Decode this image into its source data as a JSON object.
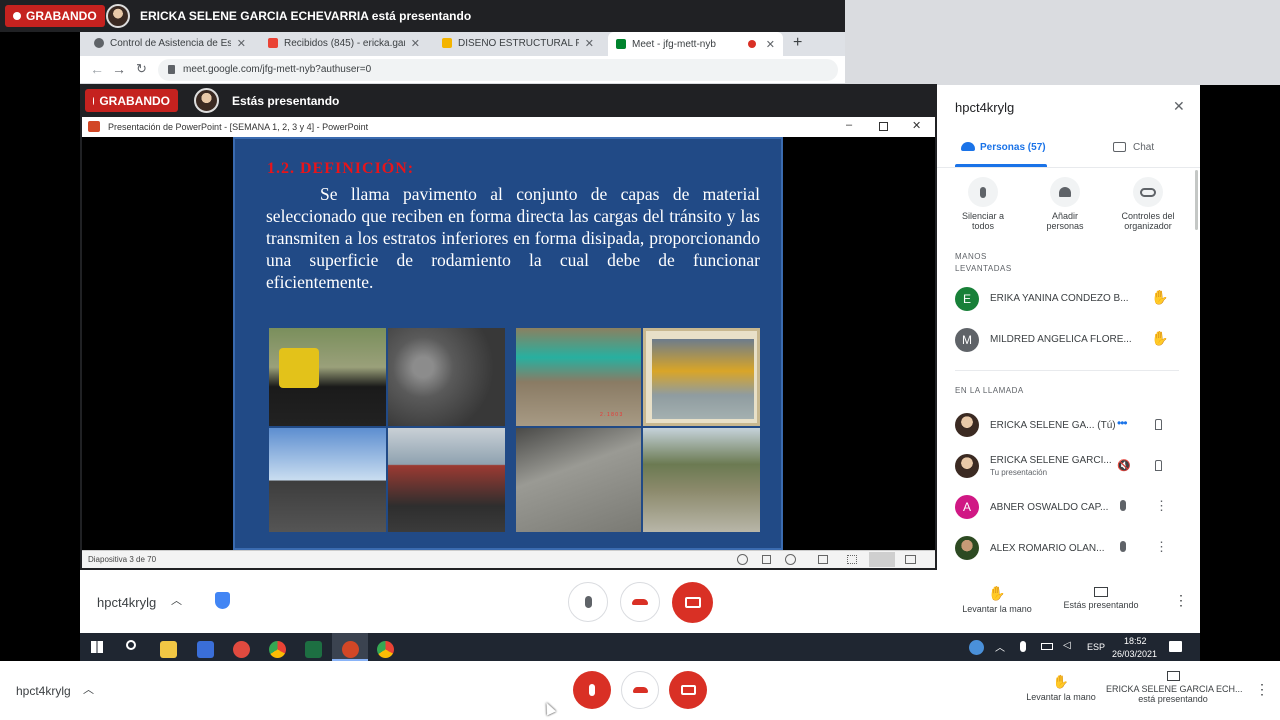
{
  "top_bar": {
    "recording": "GRABANDO",
    "presenter": "ERICKA SELENE GARCIA ECHEVARRIA está presentando"
  },
  "browser": {
    "tabs": [
      {
        "label": "Control de Asistencia de Estudia"
      },
      {
        "label": "Recibidos (845) - ericka.garcia@"
      },
      {
        "label": "DISEÑO ESTRUCTURAL PAVIMEN"
      },
      {
        "label": "Meet - jfg-mett-nyb"
      }
    ],
    "new_tab": "+",
    "url": "meet.google.com/jfg-mett-nyb?authuser=0"
  },
  "inner_bar": {
    "recording": "GRABANDO",
    "presenting": "Estás presentando"
  },
  "ppt": {
    "title": "Presentación de PowerPoint - [SEMANA 1, 2, 3 y 4] - PowerPoint",
    "heading": "1.2. DEFINICIÓN:",
    "body": "Se llama pavimento al conjunto de capas de material seleccionado que reciben en forma directa las cargas del tránsito y las transmiten a los estratos inferiores en forma disipada, proporcionando una superficie de rodamiento la cual debe de funcionar eficientemente.",
    "status": "Diapositiva 3 de 70",
    "photo_stamp": "2 . 1 8 0 3"
  },
  "meet_inner": {
    "code": "hpct4krylg",
    "raise_hand": "Levantar la mano",
    "presenting": "Estás presentando"
  },
  "taskbar": {
    "lang": "ESP",
    "time": "18:52",
    "date": "26/03/2021"
  },
  "side": {
    "title": "hpct4krylg",
    "tab_people": "Personas (57)",
    "tab_chat": "Chat",
    "controls": [
      {
        "line1": "Silenciar a",
        "line2": "todos"
      },
      {
        "line1": "Añadir",
        "line2": "personas"
      },
      {
        "line1": "Controles del",
        "line2": "organizador"
      }
    ],
    "raised_header_1": "MANOS",
    "raised_header_2": "LEVANTADAS",
    "raised": [
      {
        "initial": "E",
        "name": "ERIKA YANINA CONDEZO B...",
        "color": "#188038"
      },
      {
        "initial": "M",
        "name": "MILDRED ANGELICA FLORE...",
        "color": "#5f6368"
      }
    ],
    "call_header": "EN LA LLAMADA",
    "in_call": [
      {
        "name": "ERICKA SELENE GA... (Tú)",
        "sub": ""
      },
      {
        "name": "ERICKA SELENE GARCI...",
        "sub": "Tu presentación"
      },
      {
        "initial": "A",
        "name": "ABNER OSWALDO CAP...",
        "sub": "",
        "color": "#d01884"
      },
      {
        "name": "ALEX ROMARIO OLAN...",
        "sub": ""
      }
    ]
  },
  "bottom": {
    "code": "hpct4krylg",
    "raise_hand": "Levantar la mano",
    "presenter_line1": "ERICKA SELENE GARCIA ECH...",
    "presenter_line2": "está presentando"
  },
  "colors": {
    "record_red": "#c5221f",
    "meet_red": "#d93025",
    "slide_blue": "#214a86",
    "heading_red": "#e8141a"
  }
}
